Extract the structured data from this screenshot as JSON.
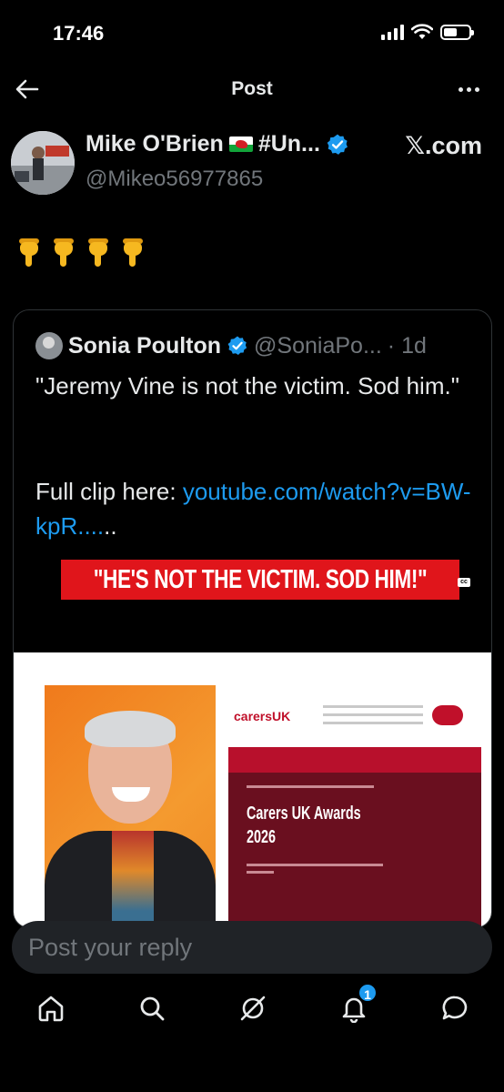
{
  "status_bar": {
    "time": "17:46"
  },
  "header": {
    "title": "Post"
  },
  "author": {
    "name": "Mike O'Brien",
    "name_suffix": "#Un...",
    "handle": "@Mikeo56977865",
    "source": "𝕏.com",
    "verified": true
  },
  "post": {
    "emojis": [
      "point-down",
      "point-down",
      "point-down",
      "point-down"
    ]
  },
  "quote": {
    "name": "Sonia Poulton",
    "handle": "@SoniaPo...",
    "time": "· 1d",
    "text": "\"Jeremy Vine is not the victim. Sod him.\"",
    "link_prefix": "Full clip here: ",
    "link": "youtube.com/watch?v=BW-kpR....",
    "link_suffix": "..",
    "media": {
      "banner": "\"HE'S NOT THE VICTIM. SOD HIM!\"",
      "cc": "cc",
      "site_logo": "carersUK",
      "site_title": "Carers UK Awards\n2026"
    }
  },
  "reply": {
    "placeholder": "Post your reply"
  },
  "tabs": [
    {
      "name": "home"
    },
    {
      "name": "search"
    },
    {
      "name": "grok"
    },
    {
      "name": "notifications",
      "badge": "1"
    },
    {
      "name": "messages"
    }
  ],
  "colors": {
    "accent": "#1d9bf0",
    "background": "#000000",
    "secondary_text": "#71767b"
  }
}
